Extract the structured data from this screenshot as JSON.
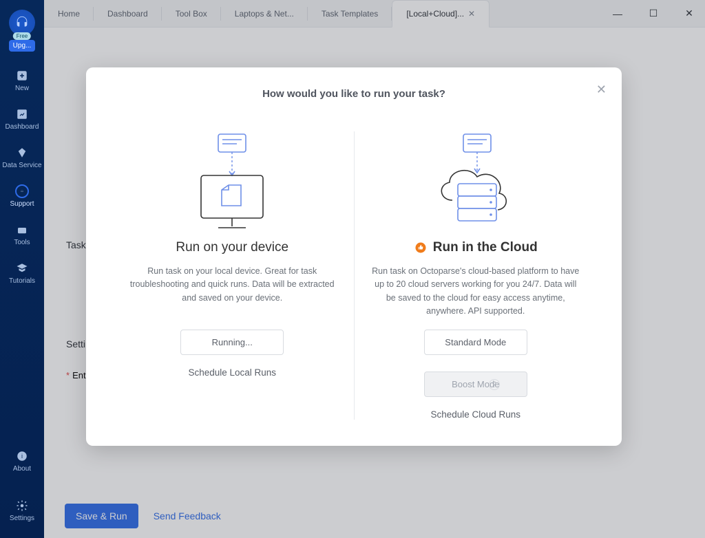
{
  "sidebar": {
    "avatar_badge": "Free",
    "upgrade_label": "Upg...",
    "items": [
      {
        "label": "New"
      },
      {
        "label": "Dashboard"
      },
      {
        "label": "Data Service"
      },
      {
        "label": "Support"
      },
      {
        "label": "Tools"
      },
      {
        "label": "Tutorials"
      }
    ],
    "bottom": [
      {
        "label": "About"
      },
      {
        "label": "Settings"
      }
    ]
  },
  "tabs": [
    {
      "label": "Home"
    },
    {
      "label": "Dashboard"
    },
    {
      "label": "Tool Box"
    },
    {
      "label": "Laptops & Net..."
    },
    {
      "label": "Task Templates"
    },
    {
      "label": "[Local+Cloud]...",
      "active": true
    }
  ],
  "background": {
    "task_info_heading": "Task Info",
    "settings_heading": "Settings",
    "required_label": "Enter t",
    "save_run": "Save & Run",
    "send_feedback": "Send Feedback"
  },
  "modal": {
    "title": "How would you like to run your task?",
    "left": {
      "title": "Run on your device",
      "desc": "Run task on your local device. Great for task troubleshooting and quick runs. Data will be extracted and saved on your device.",
      "primary_btn": "Running...",
      "secondary_link": "Schedule Local Runs"
    },
    "right": {
      "title": "Run in the Cloud",
      "desc": "Run task on Octoparse's cloud-based platform to have up to 20 cloud servers working for you 24/7. Data will be saved to the cloud for easy access anytime, anywhere. API supported.",
      "btn_standard": "Standard Mode",
      "btn_boost": "Boost Mode",
      "secondary_link": "Schedule Cloud Runs"
    }
  }
}
